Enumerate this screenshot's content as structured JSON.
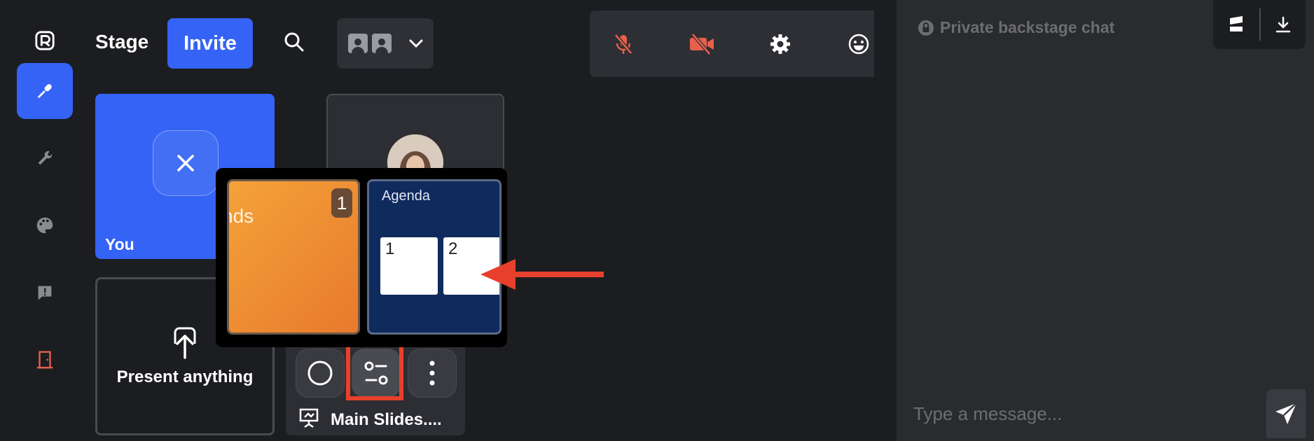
{
  "header": {
    "stage_title": "Stage",
    "invite_label": "Invite"
  },
  "tiles": {
    "you_label": "You",
    "present_label": "Present anything",
    "slides_label": "Main Slides...."
  },
  "slides": {
    "thumb1_text": "nds",
    "thumb1_badge": "1",
    "thumb2_title": "Agenda",
    "thumb2_box1": "1",
    "thumb2_box2": "2"
  },
  "chat": {
    "header": "Private backstage chat",
    "input_placeholder": "Type a message..."
  },
  "colors": {
    "accent": "#3463f5",
    "danger": "#e8402c",
    "background": "#1c1d20",
    "panel": "#2a2b2f"
  },
  "icons": {
    "rail": [
      "app-logo-icon",
      "microphone-icon",
      "wrench-icon",
      "palette-icon",
      "message-alert-icon",
      "exit-door-icon"
    ],
    "toolbar": [
      "mic-off-icon",
      "camera-off-icon",
      "gear-icon",
      "emoji-icon"
    ]
  }
}
